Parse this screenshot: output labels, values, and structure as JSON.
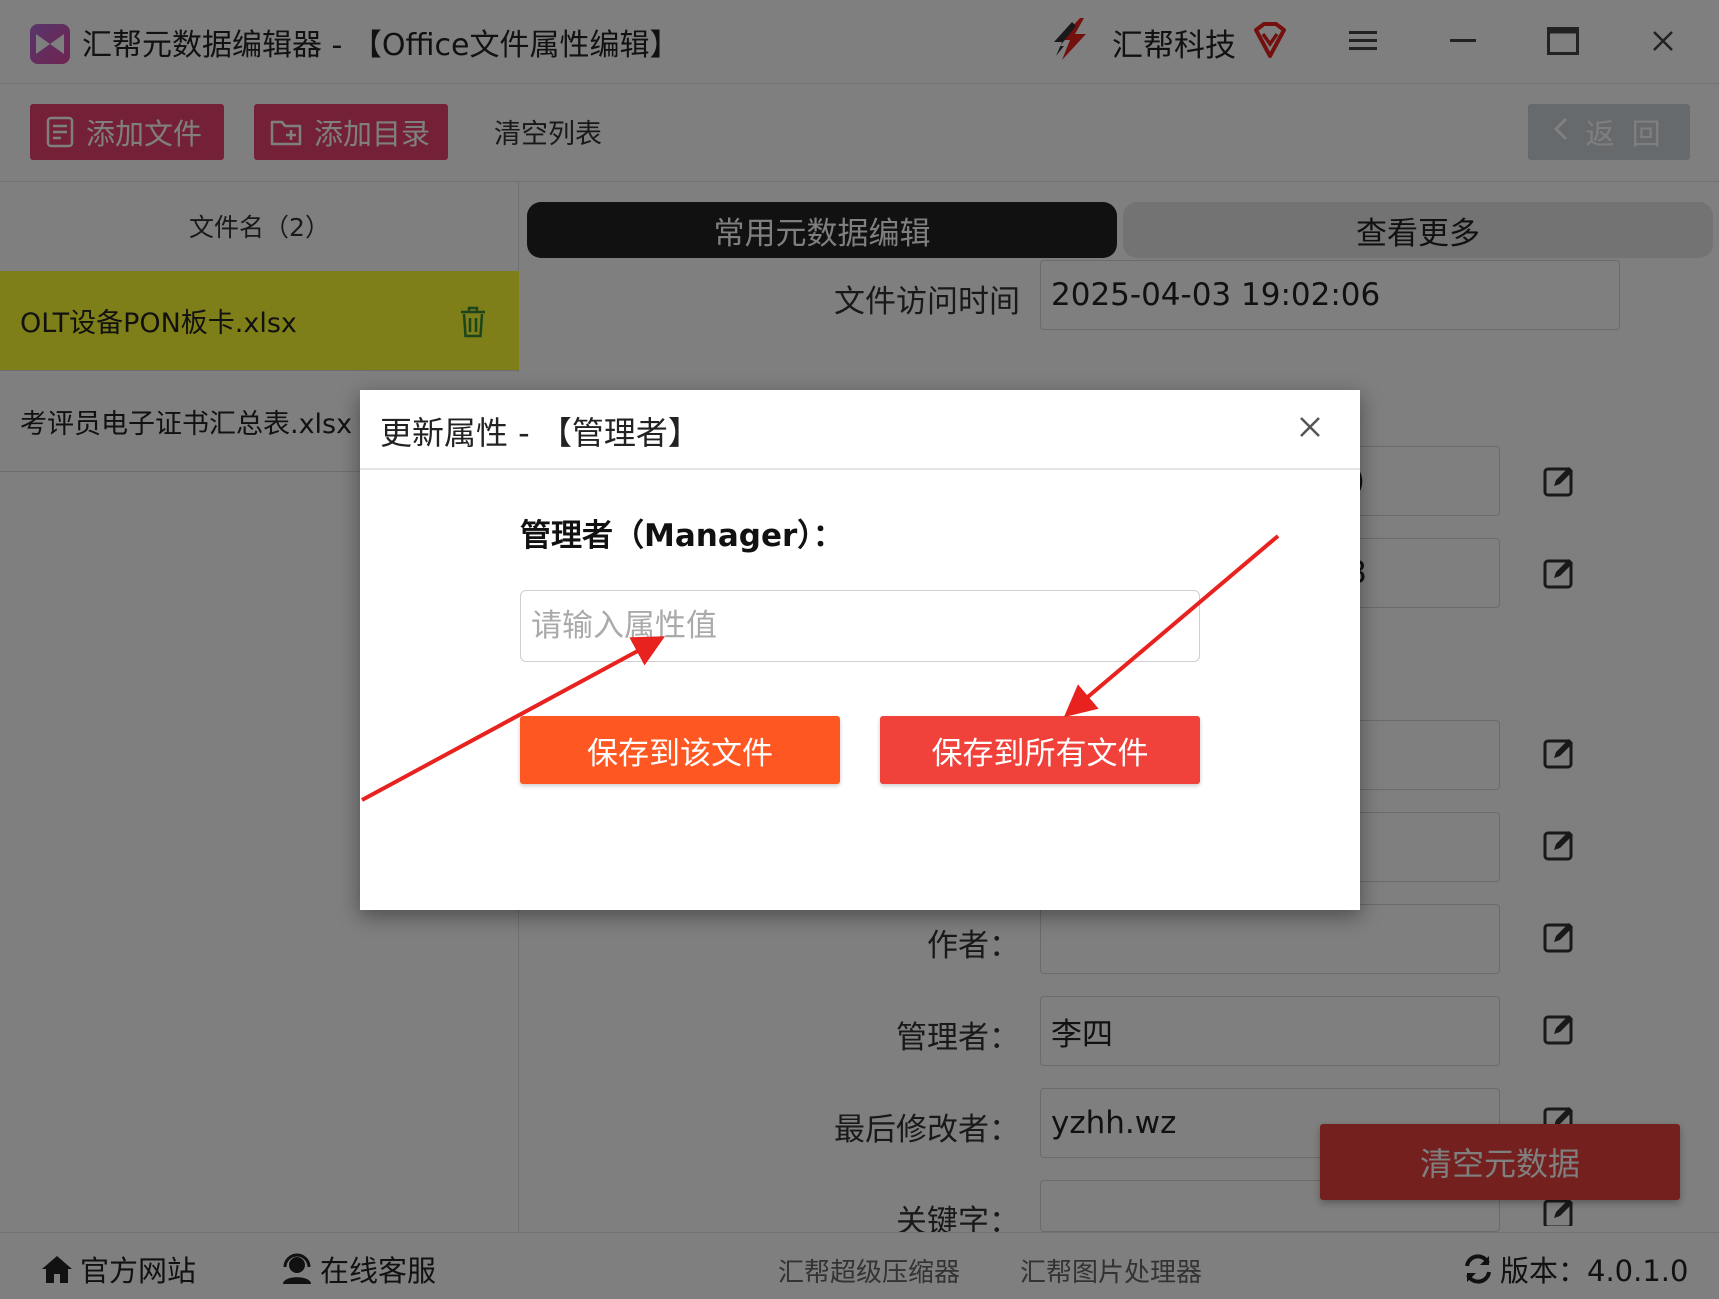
{
  "titlebar": {
    "title": "汇帮元数据编辑器 - 【Office文件属性编辑】",
    "brand": "汇帮科技"
  },
  "toolbar": {
    "add_file": "添加文件",
    "add_dir": "添加目录",
    "clear_list": "清空列表",
    "back": "返 回"
  },
  "file_list": {
    "header": "文件名（2）",
    "items": [
      {
        "name": "OLT设备PON板卡.xlsx",
        "selected": true
      },
      {
        "name": "考评员电子证书汇总表.xlsx",
        "selected": false
      }
    ]
  },
  "tabs": {
    "common": "常用元数据编辑",
    "more": "查看更多"
  },
  "fields": {
    "access_time": {
      "label": "文件访问时间",
      "value": "2025-04-03 19:02:06"
    },
    "partial_1": {
      "value": ")"
    },
    "partial_2": {
      "value": "3"
    },
    "author": {
      "label": "作者：",
      "value": ""
    },
    "manager": {
      "label": "管理者：",
      "value": "李四"
    },
    "last_modified_by": {
      "label": "最后修改者：",
      "value": "yzhh.wz"
    },
    "keywords": {
      "label": "关键字：",
      "value": ""
    }
  },
  "clear_meta": "清空元数据",
  "statusbar": {
    "website": "官方网站",
    "support": "在线客服",
    "compressor": "汇帮超级压缩器",
    "image_tool": "汇帮图片处理器",
    "version": "版本：4.0.1.0"
  },
  "dialog": {
    "title": "更新属性 - 【管理者】",
    "label": "管理者（Manager）：",
    "input_placeholder": "请输入属性值",
    "input_value": "",
    "save_this": "保存到该文件",
    "save_all": "保存到所有文件"
  },
  "colors": {
    "pink_button": "#e8436e",
    "selected_row": "#ffff33",
    "save_this": "#ff5722",
    "save_all": "#f0413a",
    "annotation_arrow": "#e8221e"
  }
}
